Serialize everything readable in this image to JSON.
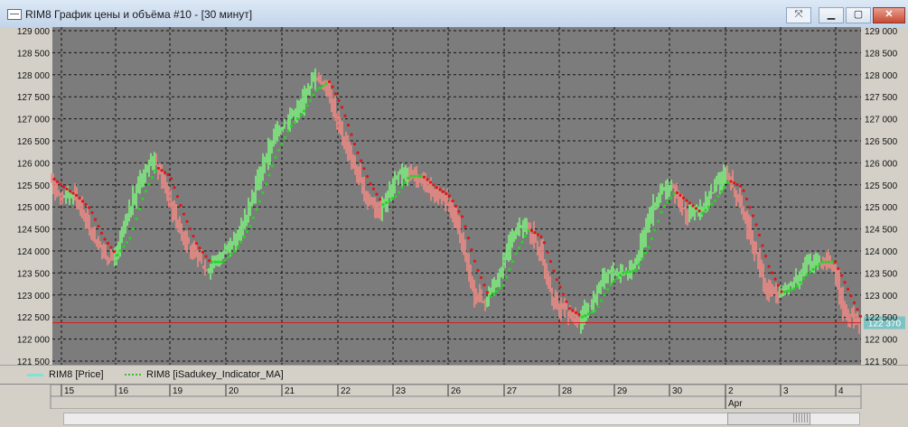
{
  "window": {
    "title": "RIM8 График цены и объёма #10 - [30 минут]",
    "pin_glyph": "⤧",
    "minimize_glyph": "▁",
    "maximize_glyph": "▢",
    "close_glyph": "✕"
  },
  "legend": {
    "price_label": "RIM8 [Price]",
    "ma_label": "RIM8 [iSadukey_Indicator_MA]"
  },
  "colors": {
    "plot_bg": "#7c7c7c",
    "grid": "#111111",
    "up_candle": "#7ff07f",
    "down_candle": "#f08a84",
    "ma_up": "#26d426",
    "ma_down": "#e01616",
    "price_line": "#d81c1c",
    "price_tag_bg": "#7ec3c3"
  },
  "chart_data": {
    "type": "line",
    "y_tick_labels": [
      "129 000",
      "128 500",
      "128 000",
      "127 500",
      "127 000",
      "126 500",
      "126 000",
      "125 500",
      "125 000",
      "124 500",
      "124 000",
      "123 500",
      "123 000",
      "122 500",
      "122 000",
      "121 500"
    ],
    "ylim": [
      121500,
      129000
    ],
    "date_labels": [
      "15",
      "16",
      "19",
      "20",
      "21",
      "22",
      "23",
      "26",
      "27",
      "28",
      "29",
      "30",
      "2",
      "3",
      "4"
    ],
    "month_label": "Apr",
    "month_label_at_index": 12,
    "current_price": 122370,
    "current_price_label": "122 370",
    "grid": true,
    "legend_position": "bottom-left",
    "price_waypoints": [
      [
        0,
        125700
      ],
      [
        1,
        125200
      ],
      [
        2,
        125300
      ],
      [
        3,
        124600
      ],
      [
        4,
        124000
      ],
      [
        5,
        123800
      ],
      [
        6,
        124800
      ],
      [
        7,
        125700
      ],
      [
        8,
        126100
      ],
      [
        9,
        125300
      ],
      [
        10,
        124400
      ],
      [
        11,
        123900
      ],
      [
        12,
        123600
      ],
      [
        13,
        123900
      ],
      [
        14,
        124200
      ],
      [
        15,
        124900
      ],
      [
        16,
        125800
      ],
      [
        17,
        126600
      ],
      [
        18,
        127000
      ],
      [
        19,
        127300
      ],
      [
        20,
        128000
      ],
      [
        21,
        127700
      ],
      [
        22,
        126700
      ],
      [
        23,
        125900
      ],
      [
        24,
        125200
      ],
      [
        25,
        124900
      ],
      [
        26,
        125600
      ],
      [
        27,
        125800
      ],
      [
        28,
        125600
      ],
      [
        29,
        125300
      ],
      [
        30,
        125200
      ],
      [
        31,
        124300
      ],
      [
        32,
        123000
      ],
      [
        33,
        122900
      ],
      [
        34,
        123500
      ],
      [
        35,
        124400
      ],
      [
        36,
        124600
      ],
      [
        37,
        124000
      ],
      [
        38,
        122800
      ],
      [
        39,
        122600
      ],
      [
        40,
        122400
      ],
      [
        41,
        122900
      ],
      [
        42,
        123500
      ],
      [
        43,
        123500
      ],
      [
        44,
        123600
      ],
      [
        45,
        124600
      ],
      [
        46,
        125300
      ],
      [
        47,
        125400
      ],
      [
        48,
        124800
      ],
      [
        49,
        124900
      ],
      [
        50,
        125400
      ],
      [
        51,
        125800
      ],
      [
        52,
        125100
      ],
      [
        53,
        124200
      ],
      [
        54,
        123100
      ],
      [
        55,
        123000
      ],
      [
        56,
        123300
      ],
      [
        57,
        123700
      ],
      [
        58,
        123800
      ],
      [
        59,
        123700
      ],
      [
        60,
        122500
      ],
      [
        61,
        122400
      ]
    ]
  }
}
